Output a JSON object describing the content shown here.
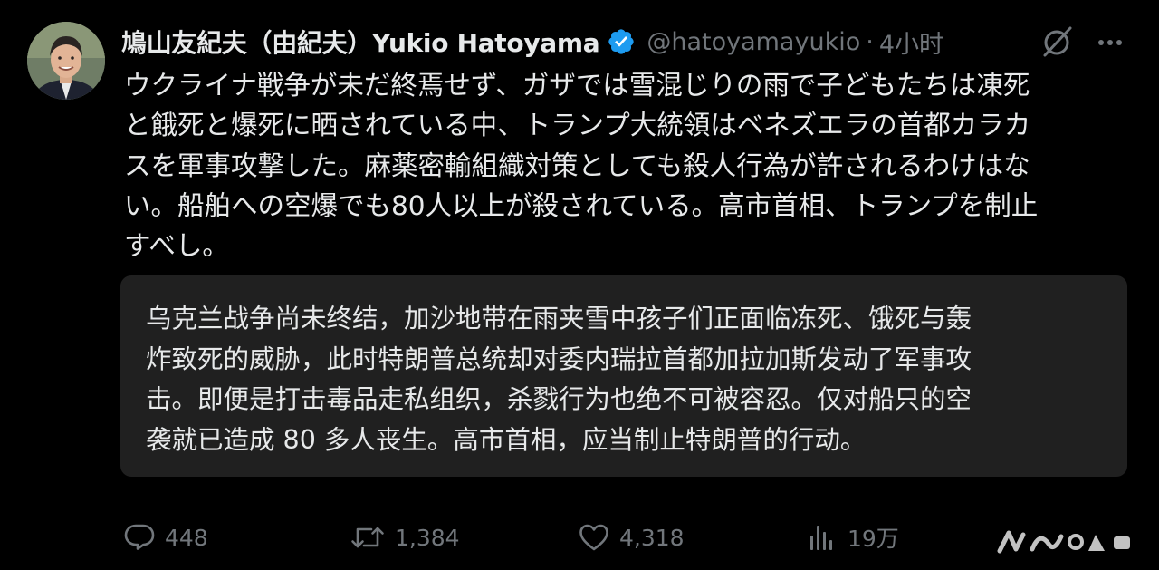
{
  "post": {
    "author": {
      "display_name": "鳩山友紀夫（由紀夫）Yukio Hatoyama",
      "handle": "@hatoyamayukio",
      "separator": "·",
      "time": "4小时",
      "verified": true
    },
    "text_lines": [
      "ウクライナ戦争が未だ終焉せず、ガザでは雪混じりの雨で子どもたちは凍死",
      "と餓死と爆死に晒されている中、トランプ大統領はベネズエラの首都カラカ",
      "スを軍事攻撃した。麻薬密輸組織対策としても殺人行為が許されるわけはな",
      "い。船舶への空爆でも80人以上が殺されている。高市首相、トランプを制止",
      "すべし。"
    ],
    "translation_lines": [
      "乌克兰战争尚未终结，加沙地带在雨夹雪中孩子们正面临冻死、饿死与轰",
      "炸致死的威胁，此时特朗普总统却对委内瑞拉首都加拉加斯发动了军事攻",
      "击。即便是打击毒品走私组织，杀戮行为也绝不可被容忍。仅对船只的空",
      "袭就已造成 80 多人丧生。高市首相，应当制止特朗普的行动。"
    ],
    "actions": {
      "replies": "448",
      "reposts": "1,384",
      "likes": "4,318",
      "views": "19万"
    },
    "icons": {
      "verified": "verified-badge-icon",
      "grok": "grok-icon",
      "more": "more-icon",
      "reply": "reply-icon",
      "repost": "repost-icon",
      "like": "like-icon",
      "views": "views-icon"
    },
    "colors": {
      "background": "#000000",
      "text": "#e7e9ea",
      "secondary_text": "#71767b",
      "verified": "#1d9bf0",
      "translation_background": "#202020"
    }
  }
}
